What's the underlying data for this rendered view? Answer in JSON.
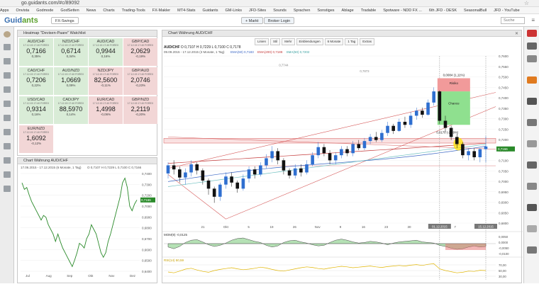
{
  "browser": {
    "url": "go.guidants.com/#c/89092",
    "bookmarks": [
      "Apps",
      "Onvista",
      "Godmode",
      "GodSetten",
      "News",
      "Charts",
      "Trading-Tools",
      "FX-Makler",
      "MT4-Stats",
      "Guidants",
      "GM-Links",
      "JFD-Sites",
      "Sounds",
      "Sprachen",
      "Sonstiges",
      "Ablage",
      "Tradable",
      "Spotware - NDD FX ...",
      "6th JFD - DESK",
      "SeasonalBull",
      "JFD - YouTube"
    ]
  },
  "app": {
    "logo_a": "Guid",
    "logo_b": "ants",
    "tab_label": "FX-Swings",
    "btn_markt": "+ Markt",
    "btn_login": "Broker Login",
    "search_placeholder": "Suche"
  },
  "heatmap": {
    "title": "Heatmap \"Devisen-Paare\" Watchlist",
    "tiles": [
      {
        "name": "AUD/CHF",
        "date": "17.12.15 17:40 FOREX",
        "price": "0,7166",
        "change": "0,35%",
        "trend": "up"
      },
      {
        "name": "NZD/CHF",
        "date": "17.12.15 17:40 FOREX",
        "price": "0,6714",
        "change": "0,34%",
        "trend": "up"
      },
      {
        "name": "AUD/CAD",
        "date": "17.12.15 17:40 FOREX",
        "price": "0,9944",
        "change": "0,16%",
        "trend": "up"
      },
      {
        "name": "GBP/CAD",
        "date": "17.12.15 17:40 FOREX",
        "price": "2,0629",
        "change": "-0,19%",
        "trend": "dn"
      },
      {
        "name": "CAD/CHF",
        "date": "17.12.15 17:40 FOREX",
        "price": "0,7206",
        "change": "0,22%",
        "trend": "up"
      },
      {
        "name": "AUD/NZD",
        "date": "17.12.15 17:40 FOREX",
        "price": "1,0669",
        "change": "0,09%",
        "trend": "up"
      },
      {
        "name": "NZD/JPY",
        "date": "17.12.15 17:40 FOREX",
        "price": "82,5600",
        "change": "-0,11%",
        "trend": "dn"
      },
      {
        "name": "GBP/AUD",
        "date": "17.12.15 17:40 FOREX",
        "price": "2,0746",
        "change": "-0,23%",
        "trend": "dn"
      },
      {
        "name": "USD/CAD",
        "date": "17.12.15 17:40 FOREX",
        "price": "0,9314",
        "change": "0,16%",
        "trend": "up"
      },
      {
        "name": "CAD/JPY",
        "date": "17.12.15 17:40 FOREX",
        "price": "88,5970",
        "change": "0,14%",
        "trend": "up"
      },
      {
        "name": "EUR/CAD",
        "date": "17.12.15 17:40 FOREX",
        "price": "1,4998",
        "change": "-0,06%",
        "trend": "dn"
      },
      {
        "name": "GBP/NZD",
        "date": "17.12.15 17:40 FOREX",
        "price": "2,2119",
        "change": "-0,20%",
        "trend": "dn"
      },
      {
        "name": "EUR/NZD",
        "date": "17.12.15 17:40 FOREX",
        "price": "1,6092",
        "change": "-0,12%",
        "trend": "dn"
      }
    ]
  },
  "small_chart": {
    "title": "Chart Währung AUD/CHF",
    "range": "17.06.2015 - 17.12.2015 (6 Monate, 1 Tag)",
    "ohlc": "O 0,7107 H 0,7229 L 0,7100 C 0,7166",
    "y_ticks": [
      "0,7400",
      "0,7300",
      "0,7200",
      "0,7000",
      "0,6900",
      "0,6800",
      "0,6700",
      "0,6600",
      "0,6500",
      "0,6400"
    ],
    "x_ticks": [
      "Jul",
      "Aug",
      "Sep",
      "Okt",
      "Nov",
      "Dez"
    ],
    "last_price": "0,7166",
    "chart_data": {
      "type": "line",
      "y_range": [
        0.64,
        0.745
      ],
      "values": [
        0.735,
        0.728,
        0.73,
        0.722,
        0.715,
        0.71,
        0.705,
        0.7,
        0.695,
        0.7,
        0.698,
        0.69,
        0.685,
        0.68,
        0.672,
        0.68,
        0.672,
        0.665,
        0.66,
        0.655,
        0.65,
        0.645,
        0.652,
        0.66,
        0.67,
        0.668,
        0.665,
        0.675,
        0.68,
        0.69,
        0.685,
        0.68,
        0.67,
        0.66,
        0.655,
        0.66,
        0.672,
        0.68,
        0.69,
        0.7,
        0.71,
        0.72,
        0.735,
        0.74,
        0.73,
        0.71,
        0.705,
        0.712,
        0.7166
      ]
    }
  },
  "main_chart": {
    "title": "Chart Währung AUD/CHF",
    "toolbar": [
      "Linien",
      "Stil",
      "Mehr",
      "Einblendungen",
      "6 Monate",
      "1 Tag",
      "Extras"
    ],
    "symbol": "AUD/CHF",
    "ohlc": "O 0,7107 H 0,7229 L 0,7100 C 0,7178",
    "range": "09.09.2015 - 17.12.2015 (3 Monate, 1 Tag)",
    "ma_labels": [
      "EMA(50) 0,7183",
      "EMA(200) 0,7188",
      "SMA(50) 0,7202"
    ],
    "y_ticks": [
      "0,7600",
      "0,7550",
      "0,7500",
      "0,7450",
      "0,7400",
      "0,7350",
      "0,7300",
      "0,7250",
      "0,7200",
      "0,7150",
      "0,7100",
      "0,7050",
      "0,7000",
      "0,6950",
      "0,6900",
      "0,6850",
      "0,6800"
    ],
    "x_ticks": [
      "21",
      "Okt",
      "5",
      "19",
      "26",
      "Nov",
      "9",
      "16",
      "23",
      "30",
      "Dez",
      "7",
      "14"
    ],
    "date_labels": [
      "01.12.2015",
      "15.12.2015"
    ],
    "level_labels": [
      "0,7744",
      "0,7873"
    ],
    "trade_box": {
      "header": "0,0084 (1,11%)",
      "risk": "Risiko",
      "chance": "Chance",
      "lower": "0,0170 (-2,39%)"
    },
    "last_price": "0,7166",
    "indicator1": {
      "label": "MOM(9) -0,0125",
      "ticks": [
        "0,0050",
        "0,0000",
        "-0,0050",
        "-0,0100"
      ]
    },
    "indicator2": {
      "label": "RSI(14) 50,59",
      "ticks": [
        "70,00",
        "50,00",
        "30,00"
      ]
    },
    "chart_data": {
      "type": "candlestick",
      "y_range": [
        0.68,
        0.7625
      ],
      "candles": [
        {
          "o": 0.7045,
          "c": 0.7085,
          "h": 0.71,
          "l": 0.702
        },
        {
          "o": 0.7085,
          "c": 0.7065,
          "h": 0.711,
          "l": 0.704
        },
        {
          "o": 0.7065,
          "c": 0.7025,
          "h": 0.708,
          "l": 0.7
        },
        {
          "o": 0.7025,
          "c": 0.705,
          "h": 0.707,
          "l": 0.699
        },
        {
          "o": 0.705,
          "c": 0.709,
          "h": 0.711,
          "l": 0.703
        },
        {
          "o": 0.709,
          "c": 0.706,
          "h": 0.71,
          "l": 0.704
        },
        {
          "o": 0.706,
          "c": 0.701,
          "h": 0.707,
          "l": 0.699
        },
        {
          "o": 0.701,
          "c": 0.697,
          "h": 0.702,
          "l": 0.694
        },
        {
          "o": 0.697,
          "c": 0.693,
          "h": 0.698,
          "l": 0.69
        },
        {
          "o": 0.693,
          "c": 0.699,
          "h": 0.7,
          "l": 0.691
        },
        {
          "o": 0.699,
          "c": 0.703,
          "h": 0.705,
          "l": 0.697
        },
        {
          "o": 0.703,
          "c": 0.7,
          "h": 0.705,
          "l": 0.698
        },
        {
          "o": 0.7,
          "c": 0.697,
          "h": 0.701,
          "l": 0.695
        },
        {
          "o": 0.697,
          "c": 0.702,
          "h": 0.704,
          "l": 0.696
        },
        {
          "o": 0.702,
          "c": 0.7065,
          "h": 0.708,
          "l": 0.7
        },
        {
          "o": 0.7065,
          "c": 0.704,
          "h": 0.708,
          "l": 0.702
        },
        {
          "o": 0.704,
          "c": 0.7085,
          "h": 0.71,
          "l": 0.703
        },
        {
          "o": 0.7085,
          "c": 0.712,
          "h": 0.714,
          "l": 0.707
        },
        {
          "o": 0.712,
          "c": 0.7155,
          "h": 0.718,
          "l": 0.71
        },
        {
          "o": 0.7155,
          "c": 0.711,
          "h": 0.717,
          "l": 0.709
        },
        {
          "o": 0.711,
          "c": 0.706,
          "h": 0.712,
          "l": 0.704
        },
        {
          "o": 0.706,
          "c": 0.7035,
          "h": 0.707,
          "l": 0.702
        },
        {
          "o": 0.7035,
          "c": 0.707,
          "h": 0.709,
          "l": 0.702
        },
        {
          "o": 0.707,
          "c": 0.705,
          "h": 0.709,
          "l": 0.703
        },
        {
          "o": 0.705,
          "c": 0.709,
          "h": 0.711,
          "l": 0.704
        },
        {
          "o": 0.709,
          "c": 0.7135,
          "h": 0.715,
          "l": 0.708
        },
        {
          "o": 0.7135,
          "c": 0.7175,
          "h": 0.72,
          "l": 0.712
        },
        {
          "o": 0.7175,
          "c": 0.7145,
          "h": 0.719,
          "l": 0.713
        },
        {
          "o": 0.7145,
          "c": 0.711,
          "h": 0.716,
          "l": 0.709
        },
        {
          "o": 0.711,
          "c": 0.7135,
          "h": 0.715,
          "l": 0.709
        },
        {
          "o": 0.7135,
          "c": 0.7165,
          "h": 0.718,
          "l": 0.712
        },
        {
          "o": 0.7165,
          "c": 0.7145,
          "h": 0.718,
          "l": 0.713
        },
        {
          "o": 0.7145,
          "c": 0.719,
          "h": 0.7205,
          "l": 0.713
        },
        {
          "o": 0.719,
          "c": 0.717,
          "h": 0.721,
          "l": 0.716
        },
        {
          "o": 0.717,
          "c": 0.7205,
          "h": 0.722,
          "l": 0.716
        },
        {
          "o": 0.7205,
          "c": 0.7225,
          "h": 0.724,
          "l": 0.719
        },
        {
          "o": 0.7225,
          "c": 0.721,
          "h": 0.725,
          "l": 0.72
        },
        {
          "o": 0.721,
          "c": 0.7245,
          "h": 0.726,
          "l": 0.72
        },
        {
          "o": 0.7245,
          "c": 0.728,
          "h": 0.73,
          "l": 0.723
        },
        {
          "o": 0.728,
          "c": 0.7255,
          "h": 0.729,
          "l": 0.724
        },
        {
          "o": 0.7255,
          "c": 0.73,
          "h": 0.7315,
          "l": 0.725
        },
        {
          "o": 0.73,
          "c": 0.7285,
          "h": 0.7325,
          "l": 0.727
        },
        {
          "o": 0.7285,
          "c": 0.733,
          "h": 0.735,
          "l": 0.727
        },
        {
          "o": 0.733,
          "c": 0.7355,
          "h": 0.737,
          "l": 0.731
        },
        {
          "o": 0.7355,
          "c": 0.7335,
          "h": 0.737,
          "l": 0.732
        },
        {
          "o": 0.7335,
          "c": 0.7395,
          "h": 0.741,
          "l": 0.733
        },
        {
          "o": 0.7395,
          "c": 0.745,
          "h": 0.747,
          "l": 0.738
        },
        {
          "o": 0.745,
          "c": 0.7305,
          "h": 0.7455,
          "l": 0.729
        },
        {
          "o": 0.7305,
          "c": 0.727,
          "h": 0.733,
          "l": 0.725
        },
        {
          "o": 0.727,
          "c": 0.7225,
          "h": 0.728,
          "l": 0.721
        },
        {
          "o": 0.7225,
          "c": 0.719,
          "h": 0.724,
          "l": 0.717
        },
        {
          "o": 0.719,
          "c": 0.7135,
          "h": 0.72,
          "l": 0.712
        },
        {
          "o": 0.7135,
          "c": 0.7155,
          "h": 0.717,
          "l": 0.711
        },
        {
          "o": 0.7155,
          "c": 0.7125,
          "h": 0.717,
          "l": 0.711
        },
        {
          "o": 0.7125,
          "c": 0.7165,
          "h": 0.717,
          "l": 0.71
        },
        {
          "o": 0.7165,
          "c": 0.7178,
          "h": 0.7229,
          "l": 0.71
        }
      ]
    }
  }
}
